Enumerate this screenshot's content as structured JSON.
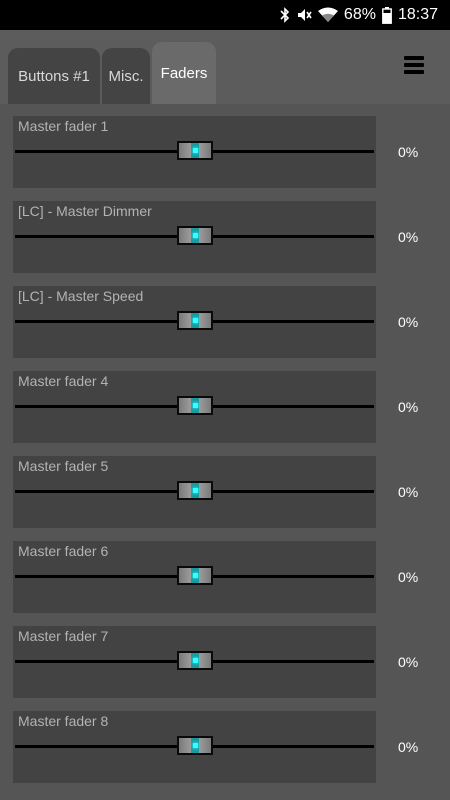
{
  "status_bar": {
    "battery": "68%",
    "time": "18:37",
    "icons": [
      "bluetooth-icon",
      "mute-icon",
      "wifi-icon",
      "battery-icon"
    ]
  },
  "tabs": [
    {
      "label": "Buttons #1",
      "active": false
    },
    {
      "label": "Misc.",
      "active": false
    },
    {
      "label": "Faders",
      "active": true
    }
  ],
  "menu_icon": "hamburger-menu-icon",
  "faders": [
    {
      "label": "Master fader 1",
      "value": "0%",
      "level": 0
    },
    {
      "label": "[LC] - Master Dimmer",
      "value": "0%",
      "level": 0
    },
    {
      "label": "[LC] - Master Speed",
      "value": "0%",
      "level": 0
    },
    {
      "label": "Master fader 4",
      "value": "0%",
      "level": 0
    },
    {
      "label": "Master fader 5",
      "value": "0%",
      "level": 0
    },
    {
      "label": "Master fader 6",
      "value": "0%",
      "level": 0
    },
    {
      "label": "Master fader 7",
      "value": "0%",
      "level": 0
    },
    {
      "label": "Master fader 8",
      "value": "0%",
      "level": 0
    }
  ],
  "colors": {
    "background": "#555555",
    "panel": "#434343",
    "active_tab": "#6a6a6a",
    "thumb_accent": "#33ffff"
  }
}
